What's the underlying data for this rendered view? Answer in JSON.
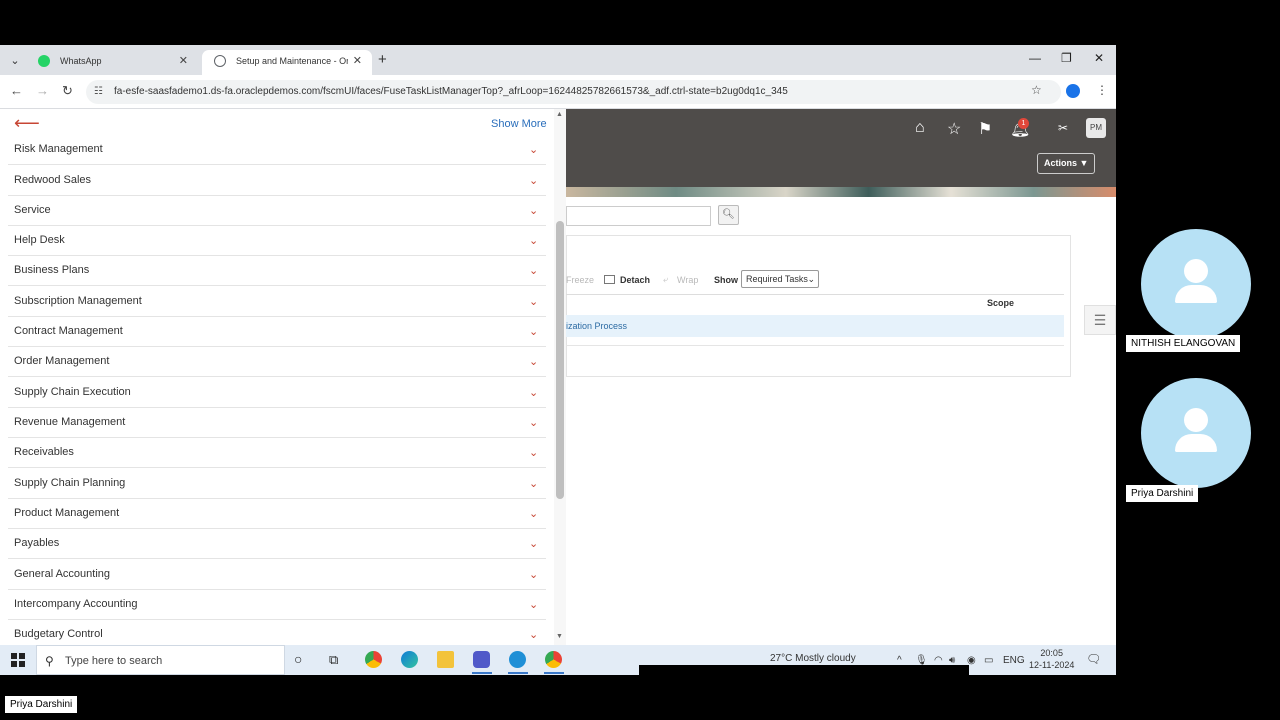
{
  "browser": {
    "tabs": [
      {
        "label": "WhatsApp",
        "active": false
      },
      {
        "label": "Setup and Maintenance - Oracle",
        "active": true
      }
    ],
    "url": "fa-esfe-saasfademo1.ds-fa.oraclepdemos.com/fscmUI/faces/FuseTaskListManagerTop?_afrLoop=16244825782661573&_adf.ctrl-state=b2ug0dq1c_345"
  },
  "drawer": {
    "show_more": "Show More",
    "items": [
      "Risk Management",
      "Redwood Sales",
      "Service",
      "Help Desk",
      "Business Plans",
      "Subscription Management",
      "Contract Management",
      "Order Management",
      "Supply Chain Execution",
      "Revenue Management",
      "Receivables",
      "Supply Chain Planning",
      "Product Management",
      "Payables",
      "General Accounting",
      "Intercompany Accounting",
      "Budgetary Control"
    ]
  },
  "header": {
    "notification_count": "1",
    "user_initials": "PM",
    "actions_label": "Actions"
  },
  "content": {
    "freeze": "Freeze",
    "detach": "Detach",
    "wrap": "Wrap",
    "show": "Show",
    "show_selected": "Required Tasks",
    "scope_header": "Scope",
    "row_link": "ization Process"
  },
  "taskbar": {
    "search_placeholder": "Type here to search",
    "weather": "27°C  Mostly cloudy",
    "language": "ENG",
    "time": "20:05",
    "date": "12-11-2024"
  },
  "participants": [
    {
      "name": "NITHISH ELANGOVAN"
    },
    {
      "name": "Priya Darshini"
    }
  ],
  "self_name": "Priya Darshini"
}
